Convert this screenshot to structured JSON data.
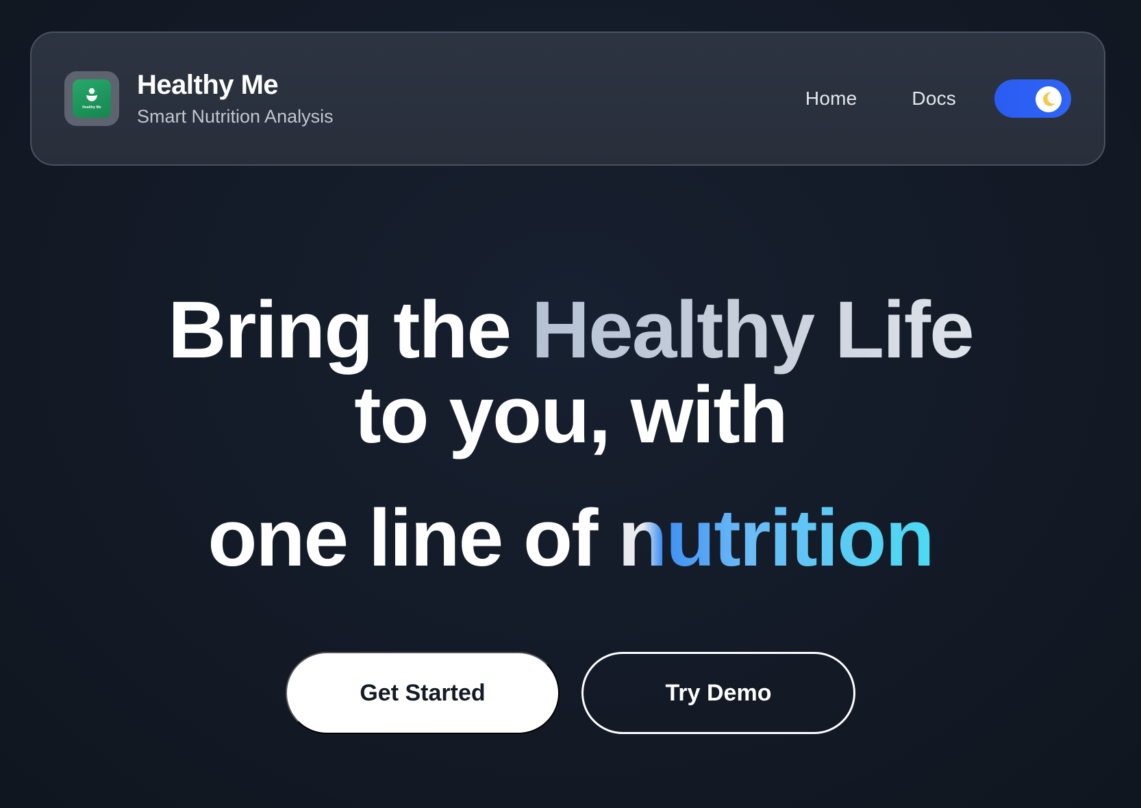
{
  "brand": {
    "logo_text": "Healthy Me",
    "title": "Healthy Me",
    "subtitle": "Smart Nutrition Analysis"
  },
  "nav": {
    "links": [
      {
        "label": "Home"
      },
      {
        "label": "Docs"
      }
    ],
    "theme_toggle": {
      "state": "dark",
      "icon": "moon-icon"
    }
  },
  "hero": {
    "line1_plain": "Bring the ",
    "line1_highlight": "Healthy Life",
    "line2": "to you, with",
    "line3_plain": "one line of ",
    "line3_highlight": "nutrition"
  },
  "cta": {
    "primary_label": "Get Started",
    "secondary_label": "Try Demo"
  },
  "colors": {
    "background": "#141b28",
    "navbar": "#2b323e",
    "toggle": "#2f64f6",
    "logo_green": "#1f9a5e",
    "accent_cyan": "#4cdbf2"
  }
}
